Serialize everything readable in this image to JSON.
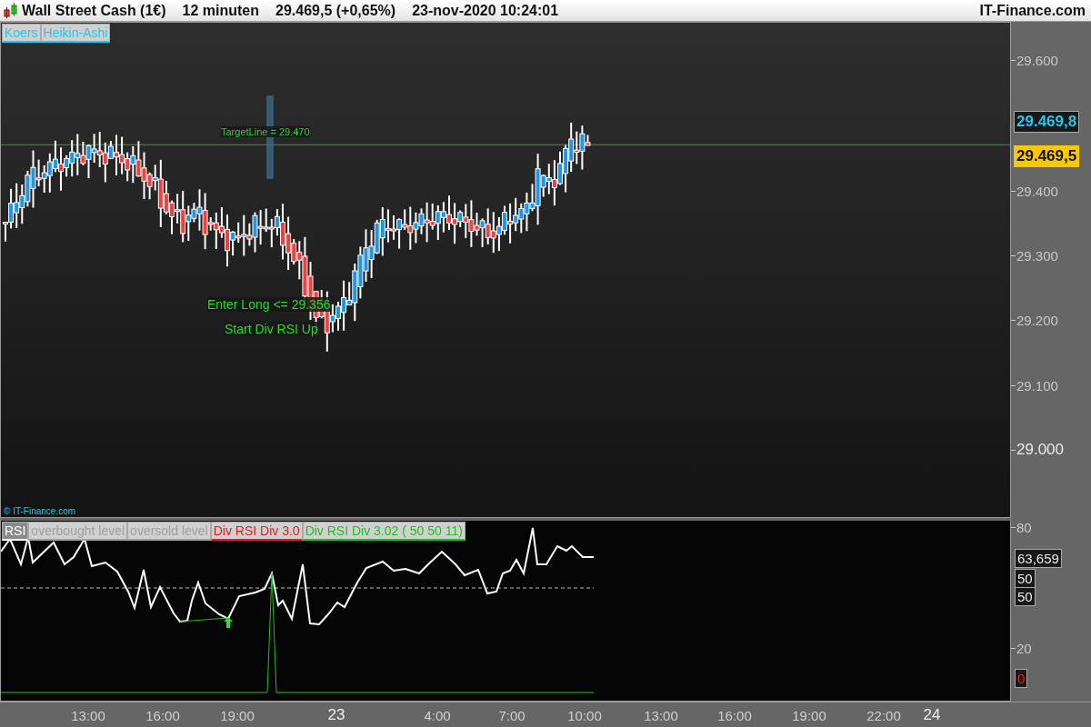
{
  "header": {
    "title": "Wall Street Cash (1€)",
    "interval": "12 minuten",
    "price": "29.469,5 (+0,65%)",
    "datetime": "23-nov-2020 10:24:01",
    "brand": "IT-Finance.com"
  },
  "price_panel": {
    "legend": [
      "Koers",
      "Heikin-Ashi"
    ],
    "annotations": [
      "TargetLine = 29.470",
      "Enter Long <= 29.356",
      "Start Div RSI Up"
    ],
    "copyright": "© IT-Finance.com",
    "axis_labels": [
      {
        "label": "29.600",
        "kind": "minor"
      },
      {
        "label": "29.400",
        "kind": "minor"
      },
      {
        "label": "29.300",
        "kind": "minor"
      },
      {
        "label": "29.200",
        "kind": "minor"
      },
      {
        "label": "29.100",
        "kind": "minor"
      },
      {
        "label": "29.000",
        "kind": "major"
      }
    ],
    "price_tags": [
      {
        "label": "29.469,8",
        "kind": "last"
      },
      {
        "label": "29.469,5",
        "kind": "quote"
      }
    ]
  },
  "rsi_panel": {
    "legend": [
      {
        "label": "RSI",
        "color": "#ffffff"
      },
      {
        "label": "overbought level",
        "color": "#a0a0a0"
      },
      {
        "label": "oversold level",
        "color": "#a0a0a0"
      },
      {
        "label": "Div RSI Div 3.0",
        "color": "#e02020"
      },
      {
        "label": "Div RSI Div 3.02 ( 50 50 11)",
        "color": "#20c020"
      }
    ],
    "axis_labels": [
      "80",
      "20"
    ],
    "value_tags": [
      {
        "label": "63,659",
        "kind": "value"
      },
      {
        "label": "50",
        "kind": "level"
      },
      {
        "label": "50",
        "kind": "level"
      },
      {
        "label": "0",
        "kind": "signal"
      }
    ]
  },
  "time_axis": [
    {
      "label": "13:00",
      "kind": "time"
    },
    {
      "label": "16:00",
      "kind": "time"
    },
    {
      "label": "19:00",
      "kind": "time"
    },
    {
      "label": "23",
      "kind": "day"
    },
    {
      "label": "4:00",
      "kind": "time"
    },
    {
      "label": "7:00",
      "kind": "time"
    },
    {
      "label": "10:00",
      "kind": "time"
    },
    {
      "label": "13:00",
      "kind": "time"
    },
    {
      "label": "16:00",
      "kind": "time"
    },
    {
      "label": "19:00",
      "kind": "time"
    },
    {
      "label": "22:00",
      "kind": "time"
    },
    {
      "label": "24",
      "kind": "day"
    }
  ]
}
